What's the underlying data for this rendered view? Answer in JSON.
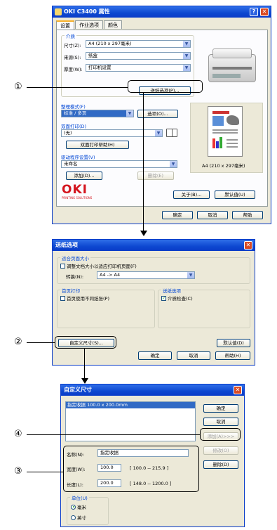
{
  "callouts": {
    "c1": "①",
    "c2": "②",
    "c3": "③",
    "c4": "④"
  },
  "win1": {
    "title": "OKI C3400 属性",
    "help_btn": "?",
    "close_btn": "✕",
    "tabs": [
      "设置",
      "作业选项",
      "颜色"
    ],
    "media_group": "介质",
    "size_label": "尺寸(Z):",
    "size_value": "A4 (210 x 297毫米)",
    "source_label": "来源(S):",
    "source_value": "纸盒",
    "weight_label": "厚度(W):",
    "weight_value": "打印机设置",
    "paper_feed_btn": "送纸选项(P)...",
    "finishing_label": "整理模式(F)",
    "finishing_value": "标准 / 多页",
    "options_btn": "选项(O)...",
    "duplex_label": "双面打印(D)",
    "duplex_value": "(无)",
    "duplex_help_btn": "双面打印帮助(H)",
    "driver_label": "驱动程序设置(V)",
    "driver_value": "未命名",
    "add_btn": "添加(D)...",
    "delete_btn": "删除(E)",
    "preview_caption": "A4 (210 x 297毫米)",
    "logo_text": "OKI",
    "logo_sub": "PRINTING SOLUTIONS",
    "about_btn": "关于(B)...",
    "default_btn": "默认值(U)",
    "ok_btn": "确定",
    "cancel_btn": "取消",
    "help_btn2": "帮助"
  },
  "win2": {
    "title": "送纸选项",
    "fit_group": "适合页面大小",
    "fit_check": "调整文档大小以适应打印机页面(F)",
    "convert_label": "转换(N):",
    "convert_value": "A4 -> A4",
    "first_page_group": "首页打印",
    "first_page_check": "首页使用不同纸张(P)",
    "feed_group": "送纸选项",
    "media_check": "介质检查(C)",
    "custom_size_btn": "自定义尺寸(S)...",
    "default_btn": "默认值(D)",
    "ok_btn": "确定",
    "cancel_btn": "取消",
    "help_btn": "帮助(H)"
  },
  "win3": {
    "title": "自定义尺寸",
    "list_item": "指定收据 100.0 x 200.0mm",
    "ok_btn": "确定",
    "cancel_btn": "取消",
    "add_btn": "添加(A)>>>",
    "modify_btn": "修改(O)",
    "delete_btn": "删除(D)",
    "name_label": "名称(N):",
    "name_value": "指定收据",
    "width_label": "宽度(W):",
    "width_value": "100.0",
    "width_range": "[ 100.0 -- 215.9 ]",
    "length_label": "长度(L):",
    "length_value": "200.0",
    "length_range": "[ 148.0 -- 1200.0 ]",
    "unit_group": "单位(U)",
    "unit_mm": "毫米",
    "unit_inch": "英寸"
  }
}
